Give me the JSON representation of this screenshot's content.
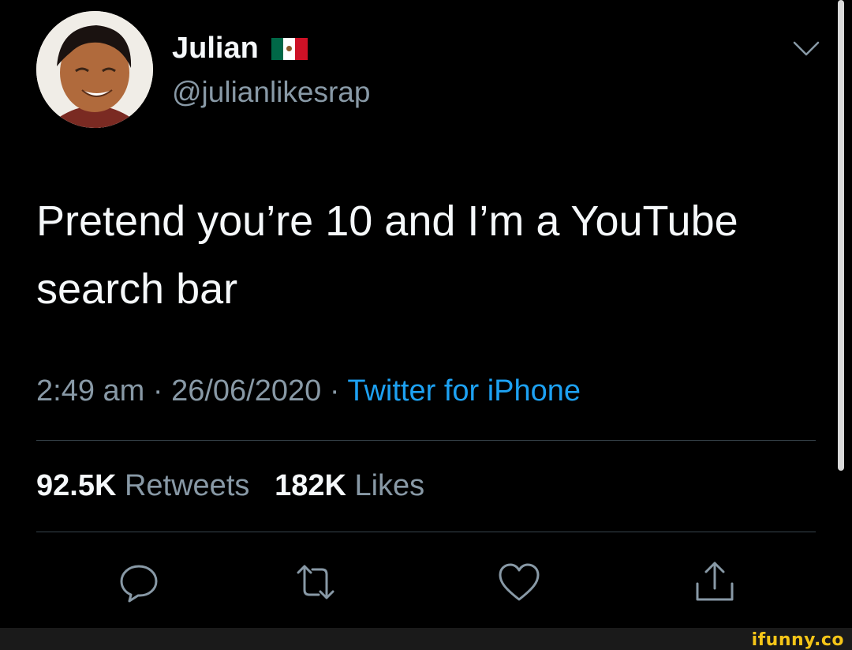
{
  "author": {
    "name": "Julian",
    "handle": "@julianlikesrap",
    "flag_icon": "mexico-flag-icon"
  },
  "tweet": {
    "text": "Pretend you’re 10 and I’m a YouTube search bar",
    "time": "2:49 am",
    "date": "26/06/2020",
    "source": "Twitter for iPhone"
  },
  "stats": {
    "retweets_count": "92.5K",
    "retweets_label": "Retweets",
    "likes_count": "182K",
    "likes_label": "Likes"
  },
  "actions": [
    "reply-icon",
    "retweet-icon",
    "like-icon",
    "share-icon"
  ],
  "colors": {
    "background": "#000000",
    "text": "#f5f8fa",
    "secondary_text": "#8899a6",
    "link": "#1da1f2",
    "divider": "#38444d",
    "watermark": "#f5c518"
  },
  "watermark": "ifunny.co"
}
